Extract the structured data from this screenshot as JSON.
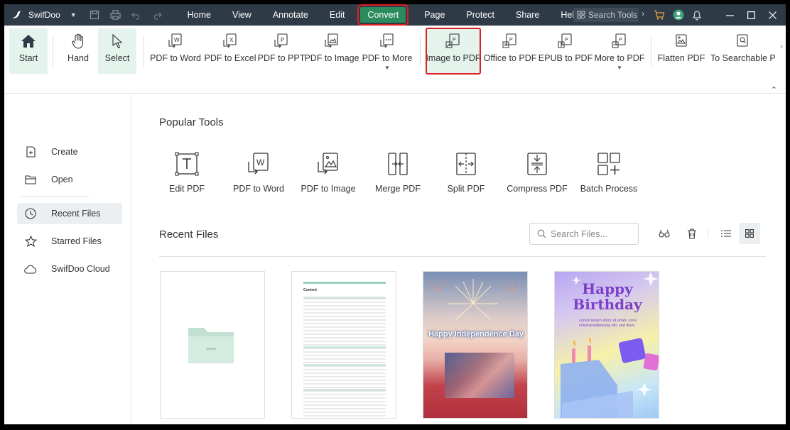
{
  "app": {
    "name": "SwifDoo"
  },
  "menu": [
    {
      "label": "Home",
      "active": false
    },
    {
      "label": "View",
      "active": false
    },
    {
      "label": "Annotate",
      "active": false
    },
    {
      "label": "Edit",
      "active": false
    },
    {
      "label": "Convert",
      "active": true
    },
    {
      "label": "Page",
      "active": false
    },
    {
      "label": "Protect",
      "active": false
    },
    {
      "label": "Share",
      "active": false
    },
    {
      "label": "Help",
      "active": false
    }
  ],
  "search_tools": {
    "placeholder": "Search Tools"
  },
  "ribbon": {
    "start": "Start",
    "hand": "Hand",
    "select": "Select",
    "pdf_to_word": "PDF to Word",
    "pdf_to_excel": "PDF to Excel",
    "pdf_to_ppt": "PDF to PPT",
    "pdf_to_image": "PDF to Image",
    "pdf_to_more": "PDF to More",
    "image_to_pdf": "Image to PDF",
    "office_to_pdf": "Office to PDF",
    "epub_to_pdf": "EPUB to PDF",
    "more_to_pdf": "More to PDF",
    "flatten_pdf": "Flatten PDF",
    "to_searchable": "To Searchable PD"
  },
  "sidebar": {
    "items": [
      {
        "label": "Create",
        "icon": "create-icon"
      },
      {
        "label": "Open",
        "icon": "folder-open-icon"
      },
      {
        "label": "Recent Files",
        "icon": "clock-icon",
        "active": true
      },
      {
        "label": "Starred Files",
        "icon": "star-icon"
      },
      {
        "label": "SwifDoo Cloud",
        "icon": "cloud-icon"
      }
    ]
  },
  "popular_tools": {
    "title": "Popular Tools",
    "items": [
      {
        "label": "Edit PDF",
        "icon": "edit-pdf-icon"
      },
      {
        "label": "PDF to Word",
        "icon": "pdf-to-word-icon"
      },
      {
        "label": "PDF to Image",
        "icon": "pdf-to-image-icon"
      },
      {
        "label": "Merge PDF",
        "icon": "merge-pdf-icon"
      },
      {
        "label": "Split PDF",
        "icon": "split-pdf-icon"
      },
      {
        "label": "Compress PDF",
        "icon": "compress-pdf-icon"
      },
      {
        "label": "Batch Process",
        "icon": "batch-process-icon"
      }
    ]
  },
  "recent_files": {
    "title": "Recent Files",
    "search_placeholder": "Search Files...",
    "thumbnails": {
      "doc_header": "Content",
      "poster1_text": "Happy Independence Day",
      "poster2_title_1": "Happy",
      "poster2_title_2": "Birthday",
      "poster2_body": "Lorem ipsum dolor sit amet, cons ectetueradipiscing elit, sed diam."
    }
  },
  "colors": {
    "titlebar": "#2e3a46",
    "accent_green": "#2b8a5e",
    "selected_bg": "#e4f3ec",
    "highlight_red": "#e02020"
  }
}
